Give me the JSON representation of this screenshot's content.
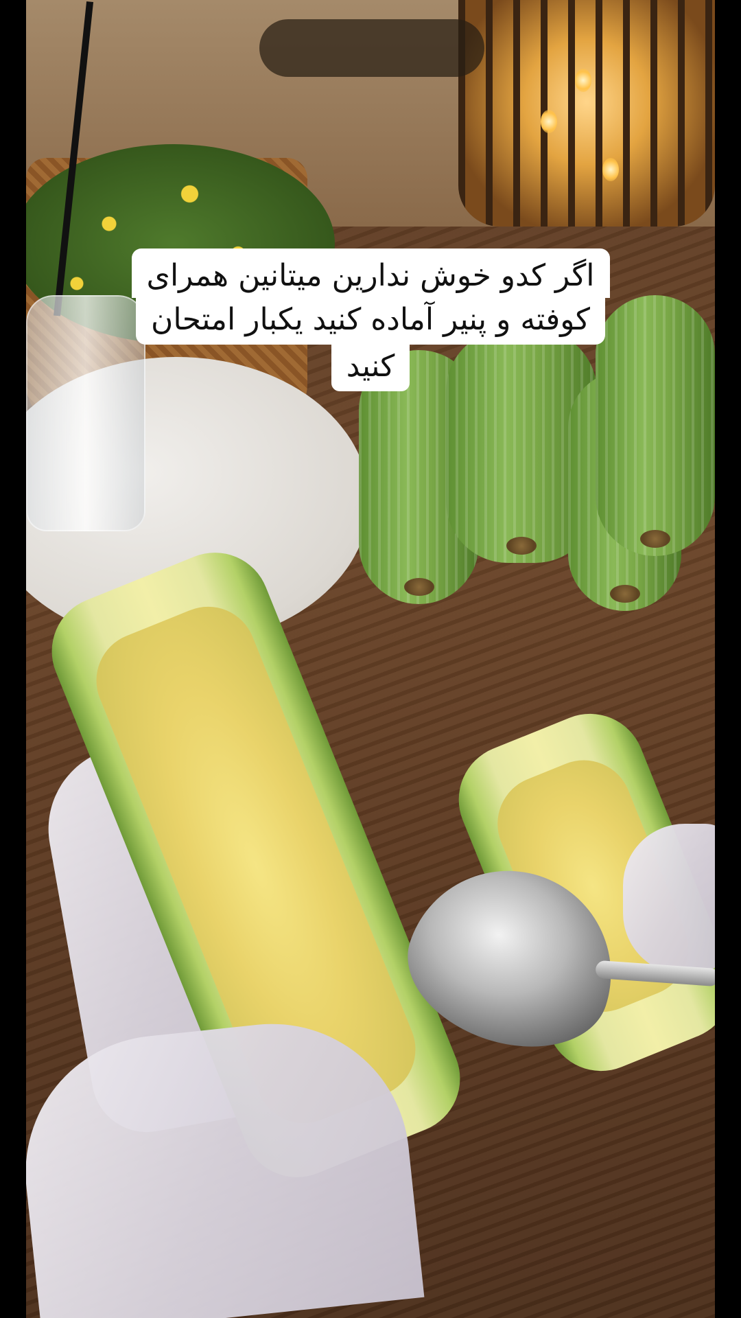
{
  "caption": {
    "line1": "اگر کدو خوش ندارین میتانین همرای",
    "line2": "کوفته و پنیر آماده کنید یکبار امتحان",
    "line3": "کنید"
  },
  "scene": {
    "icon": "video-frame",
    "description_colors": {
      "wood": "#6a4428",
      "zucchini": "#7aa847",
      "glove": "#e4e0e8"
    }
  }
}
